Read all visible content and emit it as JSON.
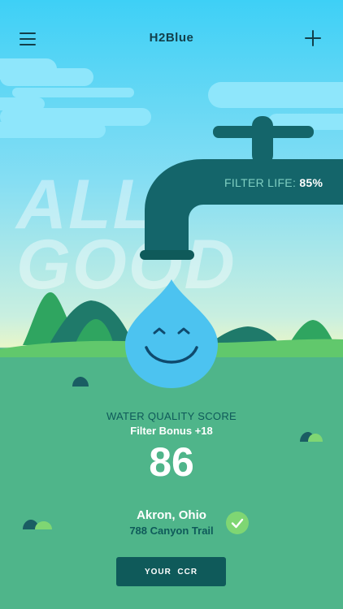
{
  "header": {
    "title": "H2Blue",
    "menu_icon": "hamburger-menu-icon",
    "add_icon": "plus-icon"
  },
  "hero": {
    "status_line1": "ALL",
    "status_line2": "GOOD",
    "filter_life_label": "FILTER LIFE:",
    "filter_life_value": "85%"
  },
  "score": {
    "label": "WATER QUALITY SCORE",
    "bonus": "Filter Bonus +18",
    "value": "86"
  },
  "location": {
    "city": "Akron, Ohio",
    "street": "788 Canyon Trail",
    "verified_icon": "checkmark-icon"
  },
  "actions": {
    "ccr_label": "YOUR  CCR"
  },
  "colors": {
    "sky_top": "#3ed0f6",
    "ground": "#4fb58a",
    "faucet": "#14656a",
    "drop": "#4cc3f0",
    "text_dark": "#0f5a5a",
    "check_green": "#7fd673"
  }
}
